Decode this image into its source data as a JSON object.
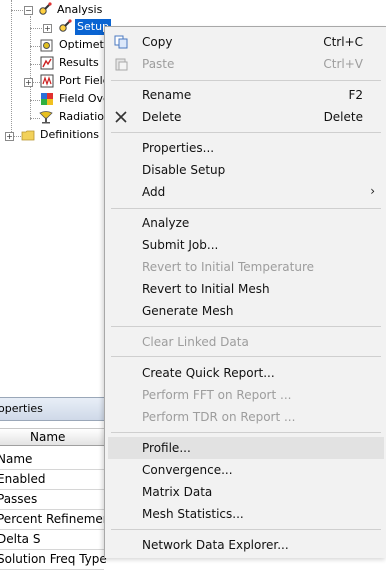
{
  "tree": {
    "items": [
      {
        "label": "Analysis",
        "icon": "analysis-icon"
      },
      {
        "label": "Setup",
        "icon": "setup-icon",
        "selected": true
      },
      {
        "label": "Optimetri",
        "icon": "optimetrics-icon"
      },
      {
        "label": "Results",
        "icon": "results-icon"
      },
      {
        "label": "Port Field",
        "icon": "port-field-icon"
      },
      {
        "label": "Field Ove",
        "icon": "field-overlays-icon"
      },
      {
        "label": "Radiation",
        "icon": "radiation-icon"
      },
      {
        "label": "Definitions",
        "icon": "folder-icon"
      }
    ]
  },
  "properties": {
    "title": "operties",
    "column_header": "Name",
    "rows": [
      "Name",
      "Enabled",
      "Passes",
      "Percent Refinement",
      "Delta S",
      "Solution Freq Type"
    ]
  },
  "menu": {
    "copy": {
      "label": "Copy",
      "shortcut": "Ctrl+C"
    },
    "paste": {
      "label": "Paste",
      "shortcut": "Ctrl+V"
    },
    "rename": {
      "label": "Rename",
      "shortcut": "F2"
    },
    "delete": {
      "label": "Delete",
      "shortcut": "Delete"
    },
    "properties": {
      "label": "Properties..."
    },
    "disable_setup": {
      "label": "Disable Setup"
    },
    "add": {
      "label": "Add",
      "arrow": "›"
    },
    "analyze": {
      "label": "Analyze"
    },
    "submit_job": {
      "label": "Submit Job..."
    },
    "revert_temp": {
      "label": "Revert to Initial Temperature"
    },
    "revert_mesh": {
      "label": "Revert to Initial Mesh"
    },
    "generate_mesh": {
      "label": "Generate Mesh"
    },
    "clear_linked": {
      "label": "Clear Linked Data"
    },
    "quick_report": {
      "label": "Create Quick Report..."
    },
    "fft": {
      "label": "Perform FFT on Report ..."
    },
    "tdr": {
      "label": "Perform TDR on Report ..."
    },
    "profile": {
      "label": "Profile..."
    },
    "convergence": {
      "label": "Convergence..."
    },
    "matrix_data": {
      "label": "Matrix Data"
    },
    "mesh_stats": {
      "label": "Mesh Statistics..."
    },
    "network_explorer": {
      "label": "Network Data Explorer..."
    }
  },
  "colors": {
    "selection": "#0a64d2",
    "menu_bg": "#f2f2f2",
    "disabled_text": "#9d9d9d"
  }
}
